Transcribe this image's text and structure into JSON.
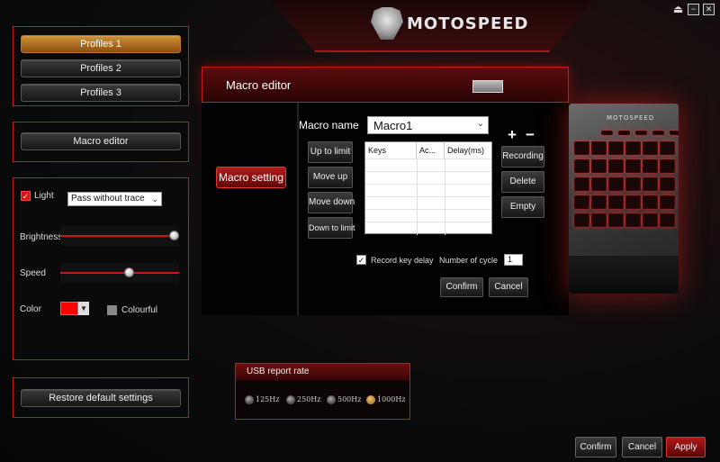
{
  "brand": {
    "logo_text": "MOTOSPEED"
  },
  "window_controls": {
    "eject": "⏏",
    "minimize": "−",
    "close": "✕"
  },
  "profiles": [
    {
      "label": "Profiles 1",
      "active": true
    },
    {
      "label": "Profiles 2",
      "active": false
    },
    {
      "label": "Profiles 3",
      "active": false
    }
  ],
  "macro_editor_nav": {
    "label": "Macro editor"
  },
  "lighting": {
    "light_label": "Light",
    "light_checked": true,
    "mode": "Pass without trace",
    "brightness_label": "Brightness",
    "brightness_level": 1.0,
    "speed_label": "Speed",
    "speed_level": 0.59,
    "color_label": "Color",
    "color_value": "#ff0000",
    "colourful_label": "Colourful",
    "colourful_checked": false
  },
  "restore": {
    "label": "Restore default settings"
  },
  "macro": {
    "header_title": "Macro editor",
    "tab_label": "Macro setting",
    "name_label": "Macro name",
    "name_value": "Macro1",
    "plus": "+",
    "minus": "−",
    "side_buttons": [
      "Up to limit",
      "Move up",
      "Move down",
      "Down to limit"
    ],
    "table": {
      "columns": [
        "Keys",
        "Ac...",
        "Delay(ms)"
      ],
      "rows": []
    },
    "right_buttons": [
      "Recording",
      "Delete",
      "Empty"
    ],
    "record_delay_label": "Record key delay",
    "record_delay_checked": true,
    "cycle_label": "Number of cycle",
    "cycle_value": "1",
    "confirm_label": "Confirm",
    "cancel_label": "Cancel"
  },
  "keyboard": {
    "brand": "MOTOSPEED"
  },
  "usb": {
    "title": "USB report rate",
    "options": [
      {
        "label": "125Hz",
        "selected": false
      },
      {
        "label": "250Hz",
        "selected": false
      },
      {
        "label": "500Hz",
        "selected": false
      },
      {
        "label": "1000Hz",
        "selected": true
      }
    ]
  },
  "footer": {
    "confirm": "Confirm",
    "cancel": "Cancel",
    "apply": "Apply"
  },
  "colors": {
    "accent_red": "#c41a1a",
    "active_orange": "#d09236"
  }
}
